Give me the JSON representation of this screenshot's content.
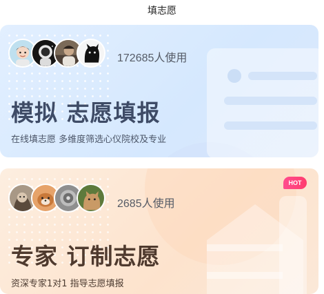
{
  "header": {
    "title": "填志愿"
  },
  "simulate_card": {
    "users_count": "172685人使用",
    "title": "模拟 志愿填报",
    "subtitle": "在线填志愿 多维度筛选心仪院校及专业",
    "colors": {
      "background": "#dbeafd",
      "title": "#3e4b66"
    },
    "avatars": [
      "cartoon-boy-avatar",
      "astronaut-avatar",
      "portrait-avatar",
      "black-cat-avatar"
    ]
  },
  "expert_card": {
    "badge": "HOT",
    "users_count": "2685人使用",
    "title": "专家 订制志愿",
    "subtitle": "资深专家1对1 指导志愿填报",
    "colors": {
      "background": "#fde8d6",
      "title": "#4f3a2e",
      "badge": "#ff4b8e"
    },
    "avatars": [
      "cat-photo-avatar",
      "dog-photo-avatar",
      "grey-animal-avatar",
      "kitten-photo-avatar"
    ]
  }
}
